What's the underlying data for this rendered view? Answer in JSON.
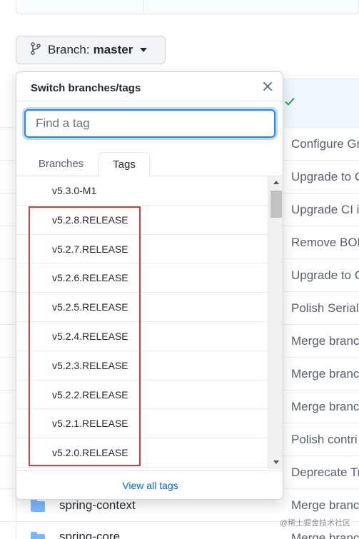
{
  "branch_button": {
    "label": "Branch:",
    "branch": "master"
  },
  "dropdown": {
    "title": "Switch branches/tags",
    "search_placeholder": "Find a tag",
    "tabs": [
      "Branches",
      "Tags"
    ],
    "active_tab": "Tags",
    "tags": [
      "v5.3.0-M1",
      "v5.2.8.RELEASE",
      "v5.2.7.RELEASE",
      "v5.2.6.RELEASE",
      "v5.2.5.RELEASE",
      "v5.2.4.RELEASE",
      "v5.2.3.RELEASE",
      "v5.2.2.RELEASE",
      "v5.2.1.RELEASE",
      "v5.2.0.RELEASE"
    ],
    "footer_link": "View all tags"
  },
  "background": {
    "commit_messages": [
      "Configure Gr",
      "Upgrade to C",
      "Upgrade CI i",
      "Remove BOM",
      "Upgrade to C",
      "Polish Seriali",
      "Merge branc",
      "Merge branc",
      "Merge branc",
      "Polish contri",
      "Deprecate Tr",
      "Merge branc",
      "Merge branc"
    ],
    "files": [
      "spring-context",
      "spring-core"
    ]
  },
  "watermark": "@稀土掘金技术社区",
  "colors": {
    "accent": "#0366d6",
    "highlight": "#d73a3a",
    "check": "#28a745"
  }
}
